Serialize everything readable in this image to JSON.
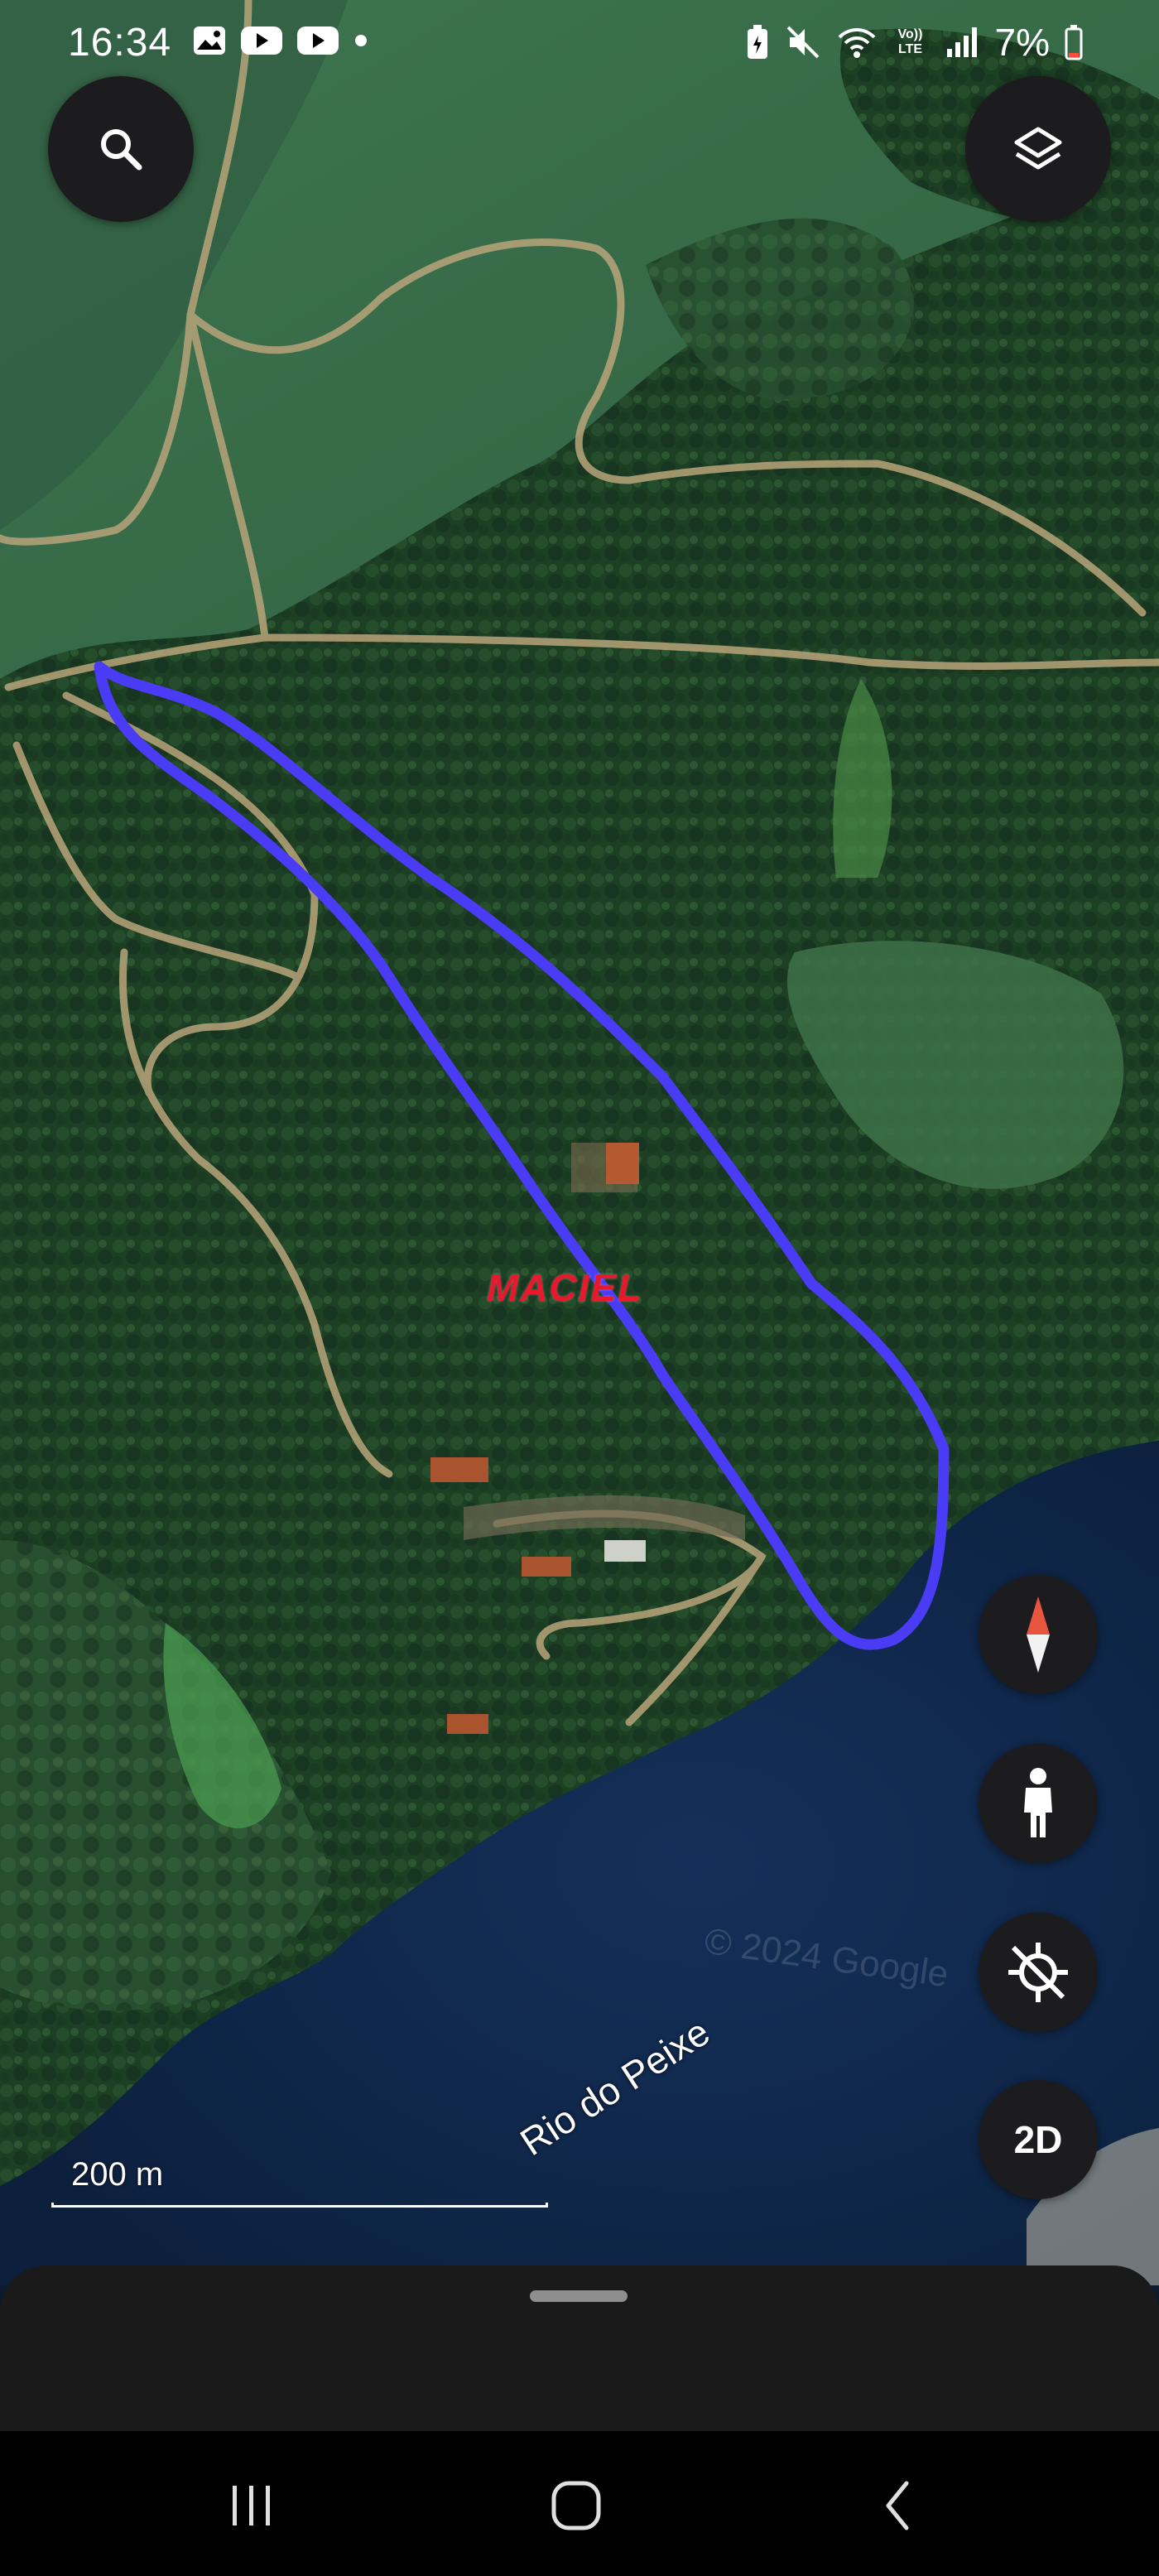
{
  "status_bar": {
    "time": "16:34",
    "left_icons": [
      "gallery-icon",
      "youtube-icon",
      "youtube-icon",
      "dot-icon"
    ],
    "right_icons": [
      "battery-saver-icon",
      "mute-icon",
      "wifi-icon",
      "volte-icon",
      "signal-icon"
    ],
    "volte_label": "Vo)) LTE",
    "battery_percent": "7%"
  },
  "map": {
    "watermark": "MACIEL",
    "copyright": "© 2024 Google",
    "river_label": "Rio do Peixe",
    "scale_label": "200 m",
    "outline_color": "#4a3cf5",
    "water_color": "#0f2446",
    "forest_color": "#1c3d22"
  },
  "controls": {
    "search_icon": "search-icon",
    "layers_icon": "layers-icon",
    "compass_icon": "compass-icon",
    "pegman_icon": "pegman-icon",
    "location_icon": "location-off-icon",
    "view_mode_label": "2D"
  },
  "nav_bar": {
    "recents_icon": "recents-icon",
    "home_icon": "home-icon",
    "back_icon": "back-icon"
  }
}
